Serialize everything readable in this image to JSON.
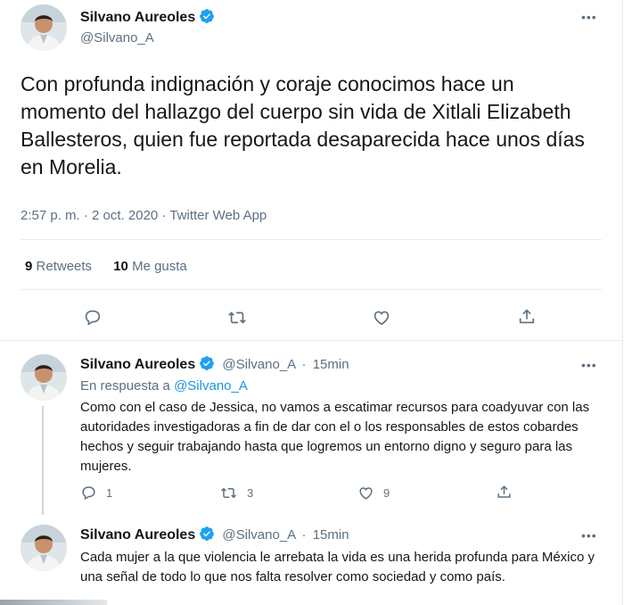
{
  "main_tweet": {
    "name": "Silvano Aureoles",
    "handle": "@Silvano_A",
    "text": "Con profunda indignación y coraje conocimos hace un momento del hallazgo del cuerpo sin vida de Xitlali Elizabeth Ballesteros, quien fue reportada desaparecida hace unos días en Morelia.",
    "meta": "2:57 p. m. · 2 oct. 2020 · Twitter Web App",
    "retweets_count": "9",
    "retweets_label": "Retweets",
    "likes_count": "10",
    "likes_label": "Me gusta"
  },
  "replies": [
    {
      "name": "Silvano Aureoles",
      "handle": "@Silvano_A",
      "sep": "·",
      "time": "15min",
      "reply_prefix": "En respuesta a",
      "reply_to": "@Silvano_A",
      "text": "Como con el caso de Jessica, no vamos a escatimar recursos para coadyuvar con las autoridades investigadoras a fin de dar con el o los responsables de estos cobardes hechos y seguir trabajando hasta que logremos un entorno digno y seguro para las mujeres.",
      "reply_count": "1",
      "retweet_count": "3",
      "like_count": "9"
    },
    {
      "name": "Silvano Aureoles",
      "handle": "@Silvano_A",
      "sep": "·",
      "time": "15min",
      "text": "Cada mujer a la que violencia le arrebata la vida es una herida profunda para México y una señal de todo lo que nos falta resolver como sociedad y como país."
    }
  ],
  "more_icon_text": "•••",
  "colors": {
    "accent": "#1da1f2",
    "muted": "#5b7083",
    "border": "#e6ecf0"
  }
}
